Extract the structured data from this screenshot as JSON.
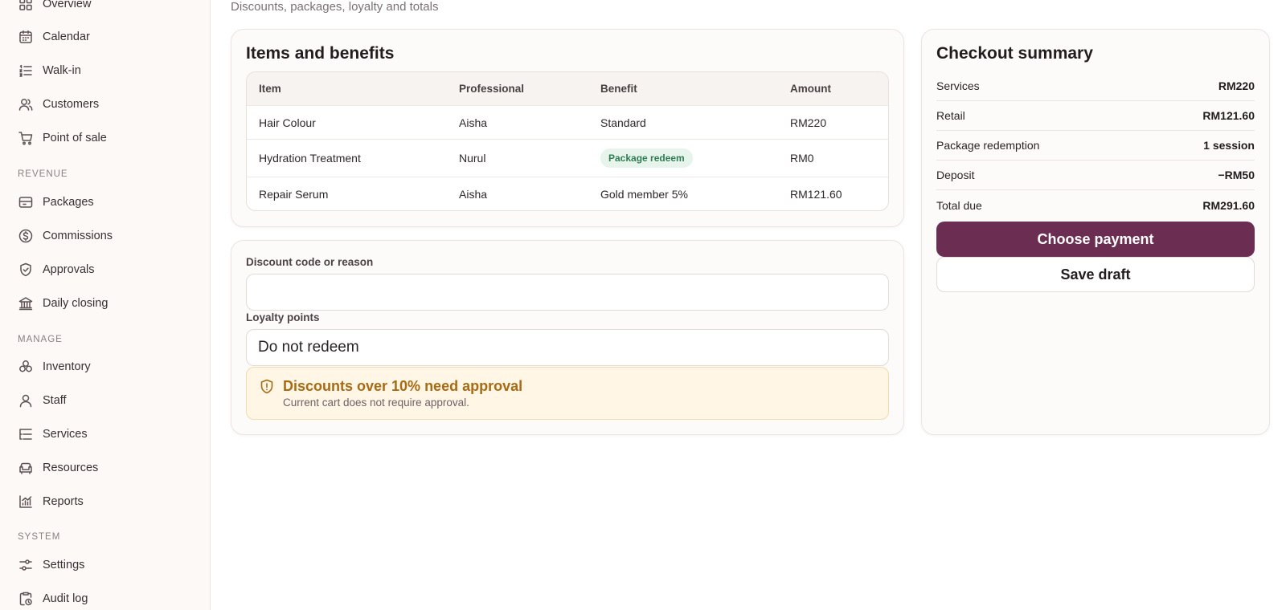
{
  "subtitle": "Discounts, packages, loyalty and totals",
  "sidebar": {
    "items_top": [
      {
        "label": "Overview",
        "icon": "grid-icon"
      },
      {
        "label": "Calendar",
        "icon": "calendar-icon"
      },
      {
        "label": "Walk-in",
        "icon": "list-icon"
      },
      {
        "label": "Customers",
        "icon": "users-icon"
      },
      {
        "label": "Point of sale",
        "icon": "cart-icon"
      }
    ],
    "revenue_label": "REVENUE",
    "items_revenue": [
      {
        "label": "Packages",
        "icon": "package-icon"
      },
      {
        "label": "Commissions",
        "icon": "dollar-circle-icon"
      },
      {
        "label": "Approvals",
        "icon": "shield-check-icon"
      },
      {
        "label": "Daily closing",
        "icon": "bank-icon"
      }
    ],
    "manage_label": "MANAGE",
    "items_manage": [
      {
        "label": "Inventory",
        "icon": "boxes-icon"
      },
      {
        "label": "Staff",
        "icon": "user-icon"
      },
      {
        "label": "Services",
        "icon": "list-tree-icon"
      },
      {
        "label": "Resources",
        "icon": "sofa-icon"
      },
      {
        "label": "Reports",
        "icon": "chart-icon"
      }
    ],
    "system_label": "SYSTEM",
    "items_system": [
      {
        "label": "Settings",
        "icon": "sliders-icon"
      },
      {
        "label": "Audit log",
        "icon": "clipboard-clock-icon"
      }
    ]
  },
  "items_card": {
    "title": "Items and benefits",
    "headers": [
      "Item",
      "Professional",
      "Benefit",
      "Amount"
    ],
    "rows": [
      {
        "item": "Hair Colour",
        "professional": "Aisha",
        "benefit": "Standard",
        "amount": "RM220"
      },
      {
        "item": "Hydration Treatment",
        "professional": "Nurul",
        "benefit": "Package redeem",
        "amount": "RM0"
      },
      {
        "item": "Repair Serum",
        "professional": "Aisha",
        "benefit": "Gold member 5%",
        "amount": "RM121.60"
      }
    ]
  },
  "discount": {
    "label": "Discount code or reason",
    "value": "",
    "placeholder": ""
  },
  "loyalty": {
    "label": "Loyalty points",
    "selected": "Do not redeem"
  },
  "alert": {
    "title": "Discounts over 10% need approval",
    "text": "Current cart does not require approval.",
    "color": "#a86a12"
  },
  "summary": {
    "title": "Checkout summary",
    "rows": [
      {
        "label": "Services",
        "value": "RM220"
      },
      {
        "label": "Retail",
        "value": "RM121.60"
      },
      {
        "label": "Package redemption",
        "value": "1 session"
      },
      {
        "label": "Deposit",
        "value": "−RM50"
      },
      {
        "label": "Total due",
        "value": "RM291.60"
      }
    ],
    "primary_button": "Choose payment",
    "secondary_button": "Save draft"
  },
  "colors": {
    "accent": "#6b2d52",
    "badge_bg": "#e6f4ec",
    "badge_text": "#2f7d53",
    "alert_bg": "#fff6e6"
  }
}
